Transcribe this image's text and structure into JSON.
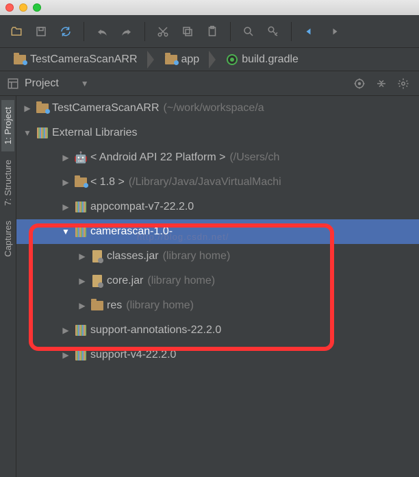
{
  "breadcrumb": {
    "root": "TestCameraScanARR",
    "app": "app",
    "file": "build.gradle"
  },
  "panel": {
    "title": "Project"
  },
  "sidebar": {
    "project": "1: Project",
    "structure": "7: Structure",
    "captures": "Captures"
  },
  "tree": {
    "root": {
      "name": "TestCameraScanARR",
      "note": "(~/work/workspace/a"
    },
    "external": {
      "name": "External Libraries"
    },
    "android": {
      "name": "< Android API 22 Platform >",
      "note": "(/Users/ch"
    },
    "jdk": {
      "name": "< 1.8 >",
      "note": "(/Library/Java/JavaVirtualMachi"
    },
    "appcompat": {
      "name": "appcompat-v7-22.2.0"
    },
    "camerascan": {
      "name": "camerascan-1.0-"
    },
    "classes": {
      "name": "classes.jar",
      "note": "(library home)"
    },
    "core": {
      "name": "core.jar",
      "note": "(library home)"
    },
    "res": {
      "name": "res",
      "note": "(library home)"
    },
    "supportann": {
      "name": "support-annotations-22.2.0"
    },
    "supportv4": {
      "name": "support-v4-22.2.0"
    }
  },
  "watermark": "http://blog.csdn.net/"
}
